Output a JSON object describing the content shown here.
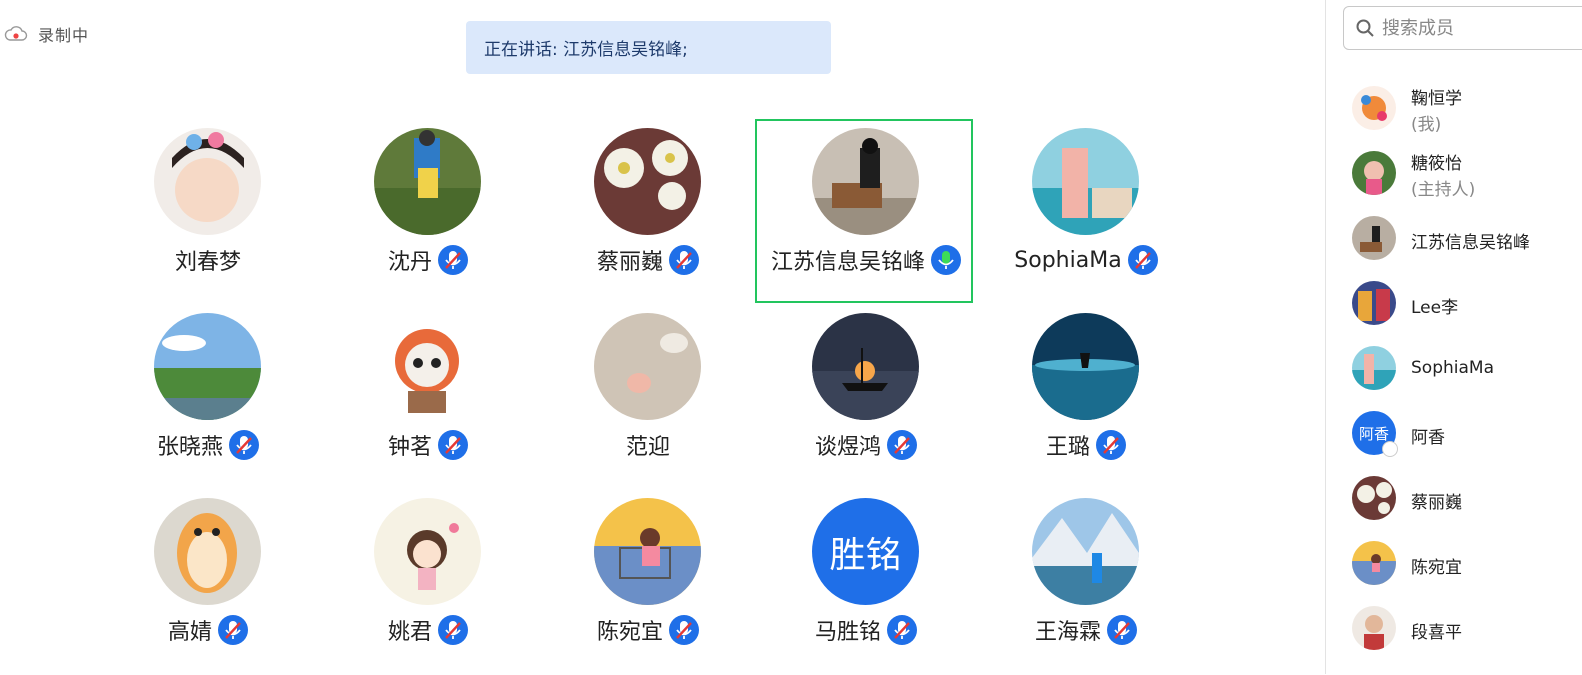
{
  "recording": {
    "label": "录制中",
    "icon": "cloud-record-icon"
  },
  "speaking_banner": {
    "text": "正在讲话: 江苏信息吴铭峰;"
  },
  "colors": {
    "accent": "#1f6fe8",
    "active_speaker": "#22c55e",
    "banner_bg": "#dbe8fb"
  },
  "participants": [
    {
      "name": "刘春梦",
      "mic": "none"
    },
    {
      "name": "沈丹",
      "mic": "muted"
    },
    {
      "name": "蔡丽巍",
      "mic": "muted"
    },
    {
      "name": "江苏信息吴铭峰",
      "mic": "speaking"
    },
    {
      "name": "SophiaMa",
      "mic": "muted"
    },
    {
      "name": "张晓燕",
      "mic": "muted"
    },
    {
      "name": "钟茗",
      "mic": "muted"
    },
    {
      "name": "范迎",
      "mic": "none"
    },
    {
      "name": "谈煜鸿",
      "mic": "muted"
    },
    {
      "name": "王璐",
      "mic": "muted"
    },
    {
      "name": "高婧",
      "mic": "muted"
    },
    {
      "name": "姚君",
      "mic": "muted"
    },
    {
      "name": "陈宛宜",
      "mic": "muted"
    },
    {
      "name": "马胜铭",
      "mic": "muted",
      "avatar_text": "胜铭"
    },
    {
      "name": "王海霖",
      "mic": "muted"
    }
  ],
  "sidebar": {
    "search_placeholder": "搜索成员",
    "members": [
      {
        "name": "鞠恒学",
        "tag": "(我)"
      },
      {
        "name": "糖筱怡",
        "tag": "(主持人)"
      },
      {
        "name": "江苏信息吴铭峰"
      },
      {
        "name": "Lee李"
      },
      {
        "name": "SophiaMa"
      },
      {
        "name": "阿香",
        "avatar_text": "阿香"
      },
      {
        "name": "蔡丽巍"
      },
      {
        "name": "陈宛宜"
      },
      {
        "name": "段喜平"
      }
    ]
  }
}
